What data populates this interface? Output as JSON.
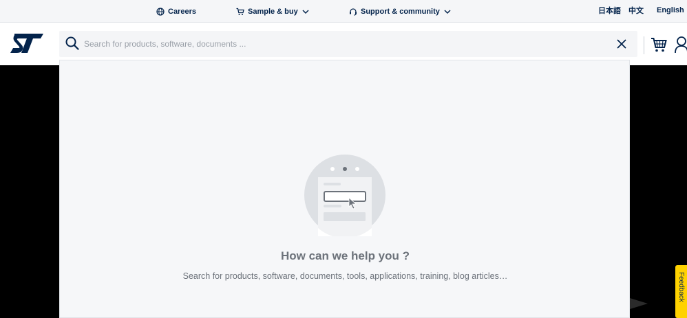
{
  "topbar": {
    "careers": "Careers",
    "sample_buy": "Sample & buy",
    "support": "Support & community",
    "languages": [
      "日本語",
      "中文",
      "English"
    ]
  },
  "header": {
    "logo_text": "ST",
    "search_placeholder": "Search for products, software, documents ...",
    "icons": [
      "search-icon",
      "close-icon",
      "cart-icon",
      "user-icon"
    ]
  },
  "panel": {
    "title": "How can we help you ?",
    "subtitle": "Search for products, software, documents, tools, applications, training, blog articles…"
  },
  "feedback": {
    "label": "Feedback"
  },
  "colors": {
    "brand_navy": "#03234b",
    "feedback_yellow": "#ffd200",
    "panel_bg": "#f6f7f9"
  }
}
